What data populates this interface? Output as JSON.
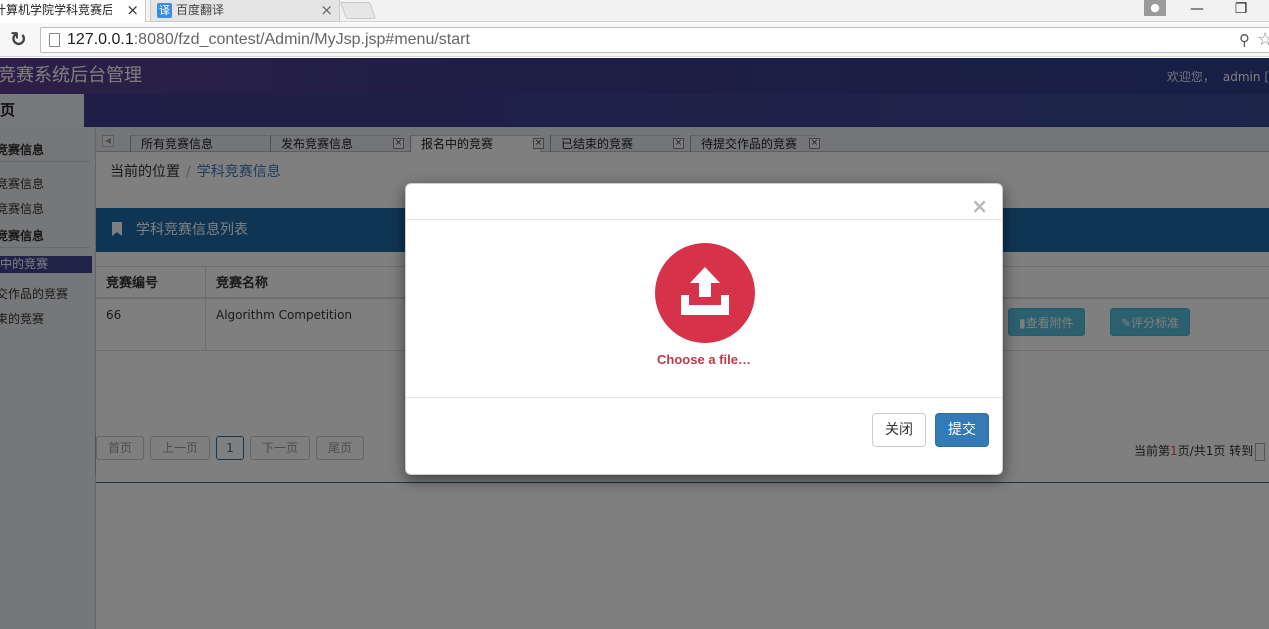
{
  "browser": {
    "tabs": [
      {
        "title": "计算机学院学科竞赛后台管理",
        "close": "×"
      },
      {
        "favicon": "译",
        "title": "百度翻译",
        "close": "×"
      }
    ],
    "url_host": "127.0.0.1",
    "url_rest": ":8080/fzd_contest/Admin/MyJsp.jsp#menu/start"
  },
  "app": {
    "title": "竞赛系统后台管理",
    "welcome": "欢迎您，",
    "user": "admin",
    "bracket": "[",
    "home_tab": "页"
  },
  "sidebar": {
    "group1": "竞赛信息",
    "g1_items": [
      "竞赛信息",
      "竞赛信息"
    ],
    "group2": "竞赛信息",
    "g2_items": [
      "中的竞赛",
      "交作品的竞赛",
      "束的竞赛"
    ]
  },
  "content_tabs": [
    {
      "label": "所有竞赛信息"
    },
    {
      "label": "发布竞赛信息"
    },
    {
      "label": "报名中的竞赛"
    },
    {
      "label": "已结束的竞赛"
    },
    {
      "label": "待提交作品的竞赛"
    }
  ],
  "breadcrumb": {
    "root": "当前的位置",
    "sep": "/",
    "current": "学科竞赛信息"
  },
  "panel": {
    "title": "学科竞赛信息列表"
  },
  "table": {
    "headers": [
      "竞赛编号",
      "竞赛名称"
    ],
    "rows": [
      {
        "id": "66",
        "name": "Algorithm Competition",
        "btn_attach": "查看附件",
        "btn_standard": "评分标准"
      }
    ]
  },
  "pager": {
    "first": "首页",
    "prev": "上一页",
    "page": "1",
    "next": "下一页",
    "last": "尾页",
    "info_prefix": "当前第",
    "current": "1",
    "info_mid": "页/共",
    "total": "1",
    "info_suffix": "页 转到"
  },
  "modal": {
    "close_x": "×",
    "choose_file": "Choose a file…",
    "btn_close": "关闭",
    "btn_submit": "提交",
    "accent": "#d6334a"
  }
}
